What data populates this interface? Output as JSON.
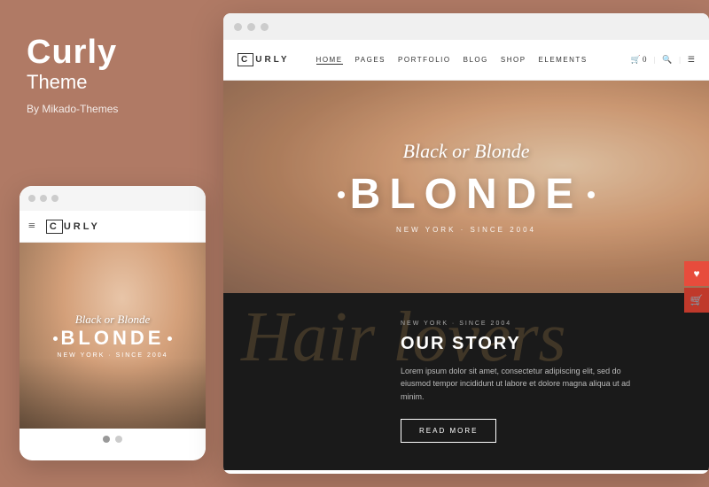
{
  "left": {
    "brand": "Curly",
    "theme": "Theme",
    "author": "By Mikado-Themes"
  },
  "mobile": {
    "dots": [
      "dot1",
      "dot2",
      "dot3"
    ],
    "logo": "CURLY",
    "logo_first": "C",
    "nav_icon": "≡",
    "hero_script": "Black or Blonde",
    "hero_title": "BLONDE",
    "hero_tagline": "NEW YORK · SINCE 2004",
    "indicators": [
      1,
      2
    ]
  },
  "desktop": {
    "window_dots": [
      "dot1",
      "dot2",
      "dot3"
    ],
    "logo_first": "C",
    "logo_rest": "URLY",
    "nav_links": [
      {
        "label": "HOME",
        "active": true
      },
      {
        "label": "PAGES",
        "active": false
      },
      {
        "label": "PORTFOLIO",
        "active": false
      },
      {
        "label": "BLOG",
        "active": false
      },
      {
        "label": "SHOP",
        "active": false
      },
      {
        "label": "ELEMENTS",
        "active": false
      }
    ],
    "nav_cart": "🛒 0",
    "nav_search": "🔍",
    "nav_menu": "☰",
    "hero": {
      "script": "Black or Blonde",
      "title": "BLONDE",
      "tagline": "NEW YORK · SINCE 2004"
    },
    "story": {
      "bg_script": "Hair lovers",
      "eyebrow": "NEW YORK · SINCE 2004",
      "title": "OUR STORY",
      "body": "Lorem ipsum dolor sit amet, consectetur adipiscing elit, sed do eiusmod tempor incididunt ut labore et dolore magna aliqua ut ad minim.",
      "cta": "READ MORE"
    },
    "float_icons": {
      "heart": "♥",
      "cart": "🛒"
    }
  }
}
